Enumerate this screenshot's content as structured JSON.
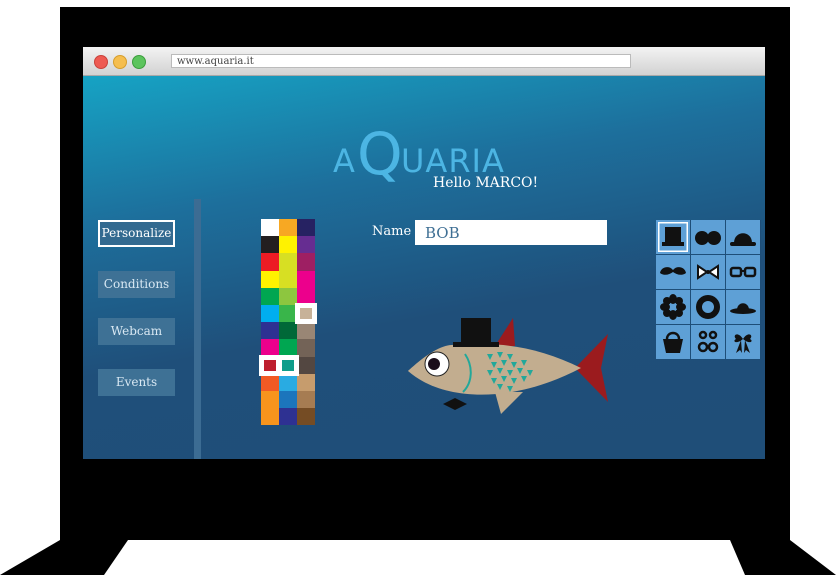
{
  "browser": {
    "url": "www.aquaria.it"
  },
  "logo": {
    "a": "A",
    "q": "Q",
    "rest": "UARIA"
  },
  "greeting": "Hello MARCO!",
  "nav": {
    "items": [
      {
        "label": "Personalize",
        "active": true
      },
      {
        "label": "Conditions",
        "active": false
      },
      {
        "label": "Webcam",
        "active": false
      },
      {
        "label": "Events",
        "active": false
      }
    ]
  },
  "name_field": {
    "label": "Name",
    "value": "BOB"
  },
  "palette": {
    "columns": [
      [
        "#ffffff",
        "#231f20",
        "#ed1c24",
        "#fff200",
        "#00a651",
        "#00aeef",
        "#2e3192",
        "#ec008c",
        "#be1e2d",
        "#f15a24",
        "#f7941d",
        "#f7941d"
      ],
      [
        "#f7a823",
        "#fff200",
        "#d7df23",
        "#d7df23",
        "#8dc63f",
        "#39b54a",
        "#006838",
        "#00a651",
        "#0f9d8a",
        "#29abe2",
        "#1c75bc",
        "#2e3192"
      ],
      [
        "#262262",
        "#662d91",
        "#9e1f63",
        "#ec008c",
        "#ec008c",
        "#c7b299",
        "#998675",
        "#736357",
        "#534741",
        "#c69c6d",
        "#a67c52",
        "#754c24"
      ]
    ],
    "selected": [
      "#c7b299",
      "#be1e2d",
      "#0f9d8a"
    ]
  },
  "accessories": {
    "icons": [
      "top-hat-icon",
      "sunglasses-round-icon",
      "bowler-hat-icon",
      "mustache-icon",
      "bow-tie-icon",
      "glasses-icon",
      "flower-icon",
      "ring-icon",
      "sun-hat-icon",
      "basket-icon",
      "bow-pair-icon",
      "ribbon-icon"
    ],
    "selected": "top-hat-icon"
  },
  "colors": {
    "page_dark": "#1f4e78",
    "page_light": "#16a3c4",
    "nav_button": "#3e7195",
    "accent_blue": "#4cb5e3",
    "fish_body": "#c2ad8f",
    "fish_fin": "#9b1b1e",
    "fish_spots": "#22a89a"
  }
}
